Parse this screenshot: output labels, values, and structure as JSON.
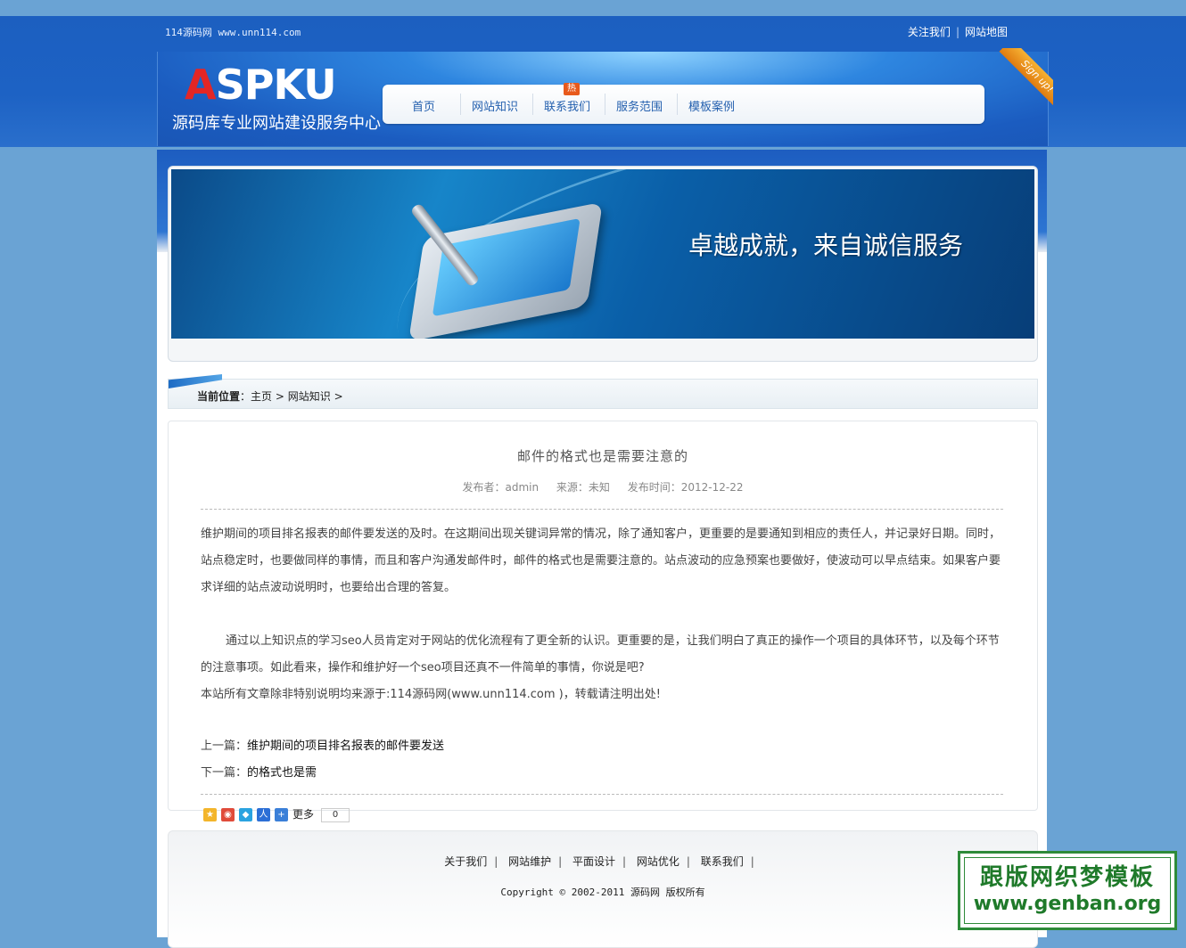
{
  "topbar": {
    "site_text": "114源码网 www.unn114.com",
    "follow_link": "关注我们",
    "sitemap_link": "网站地图"
  },
  "header": {
    "logo_a": "A",
    "logo_rest": "SPKU",
    "tagline": "源码库专业网站建设服务中心",
    "ribbon": "Sign up!",
    "nav": [
      "首页",
      "网站知识",
      "联系我们",
      "服务范围",
      "模板案例"
    ],
    "hot_badge": "热"
  },
  "banner": {
    "slogan": "卓越成就，来自诚信服务"
  },
  "breadcrumb": {
    "label": "当前位置",
    "home": "主页",
    "section": "网站知识"
  },
  "article": {
    "title": "邮件的格式也是需要注意的",
    "publisher": "发布者：admin",
    "source": "来源：未知",
    "date": "发布时间：2012-12-22",
    "para1": "维护期间的项目排名报表的邮件要发送的及时。在这期间出现关键词异常的情况，除了通知客户，更重要的是要通知到相应的责任人，并记录好日期。同时，站点稳定时，也要做同样的事情，而且和客户沟通发邮件时，邮件的格式也是需要注意的。站点波动的应急预案也要做好，使波动可以早点结束。如果客户要求详细的站点波动说明时，也要给出合理的答复。",
    "para2": "通过以上知识点的学习seo人员肯定对于网站的优化流程有了更全新的认识。更重要的是，让我们明白了真正的操作一个项目的具体环节，以及每个环节的注意事项。如此看来，操作和维护好一个seo项目还真不一件简单的事情，你说是吧?",
    "para3": "本站所有文章除非特别说明均来源于:114源码网(www.unn114.com )，转载请注明出处!",
    "prev_label": "上一篇：",
    "prev_title": "维护期间的项目排名报表的邮件要发送",
    "next_label": "下一篇：",
    "next_title": "的格式也是需"
  },
  "share": {
    "more": "更多",
    "count": "0"
  },
  "footer": {
    "links": [
      "关于我们",
      "网站维护",
      "平面设计",
      "网站优化",
      "联系我们"
    ],
    "copyright": "Copyright © 2002-2011 源码网 版权所有"
  },
  "watermark": {
    "line1": "跟版网织梦模板",
    "line2": "www.genban.org"
  }
}
